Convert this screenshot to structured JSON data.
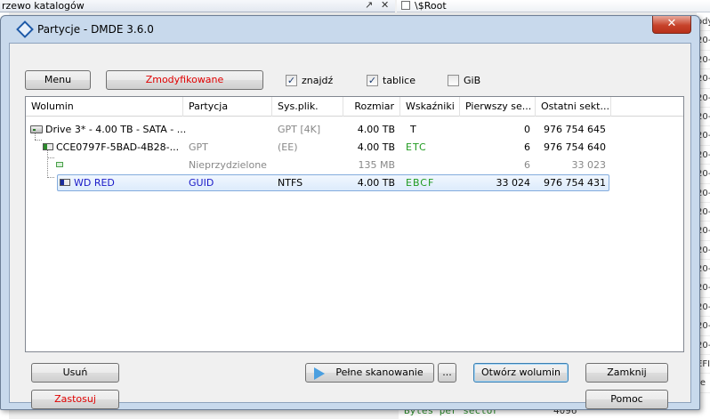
{
  "background": {
    "left_panel_title": "rzewo katalogów",
    "left_panel_controls": [
      "↗",
      "✕"
    ],
    "root_label": "\\$Root",
    "right_column_fragments": [
      "ody",
      "20-",
      "20-",
      "20-",
      "20-",
      "20-",
      "20-",
      "20-",
      "20-",
      "20-",
      "20-",
      "20-",
      "20-",
      "20-",
      "20-",
      "20-",
      "20-",
      "20-",
      "EFI",
      "re"
    ],
    "bottom_field": "Bytes per sector",
    "bottom_value": "4096"
  },
  "dialog": {
    "title": "Partycje - DMDE 3.6.0",
    "close_glyph": "✕"
  },
  "toolbar": {
    "menu_label": "Menu",
    "modified_label": "Zmodyfikowane",
    "checkboxes": [
      {
        "label": "znajdź",
        "checked": true
      },
      {
        "label": "tablice",
        "checked": true
      },
      {
        "label": "GiB",
        "checked": false
      }
    ],
    "check_glyph": "✓"
  },
  "table": {
    "columns": [
      "Wolumin",
      "Partycja",
      "Sys.plik.",
      "Rozmiar",
      "Wskaźniki",
      "Pierwszy se...",
      "Ostatni sekt..."
    ],
    "rows": [
      {
        "icon": "disk-icon",
        "volume": "Drive 3* - 4.00 TB - SATA - ...",
        "partition": "",
        "fs": "GPT [4K]",
        "size": "4.00 TB",
        "flags": "T",
        "first": "0",
        "last": "976 754 645"
      },
      {
        "icon": "partition-table-icon",
        "volume": "CCE0797F-5BAD-4B28-...",
        "partition": "GPT",
        "fs": "(EE)",
        "size": "4.00 TB",
        "flags": "ETC",
        "first": "6",
        "last": "976 754 640"
      },
      {
        "icon": "unallocated-icon",
        "volume": "",
        "partition": "Nieprzydzielone",
        "fs": "",
        "size": "135 MB",
        "flags": "",
        "first": "6",
        "last": "33 023"
      },
      {
        "icon": "volume-icon",
        "volume": "WD RED",
        "partition": "GUID",
        "fs": "NTFS",
        "size": "4.00 TB",
        "flags": "EBCF",
        "first": "33 024",
        "last": "976 754 431"
      }
    ]
  },
  "footer": {
    "delete_label": "Usuń",
    "apply_label": "Zastosuj",
    "full_scan_label": "Pełne skanowanie",
    "more_label": "...",
    "open_volume_label": "Otwórz wolumin",
    "close_label": "Zamknij",
    "help_label": "Pomoc"
  }
}
